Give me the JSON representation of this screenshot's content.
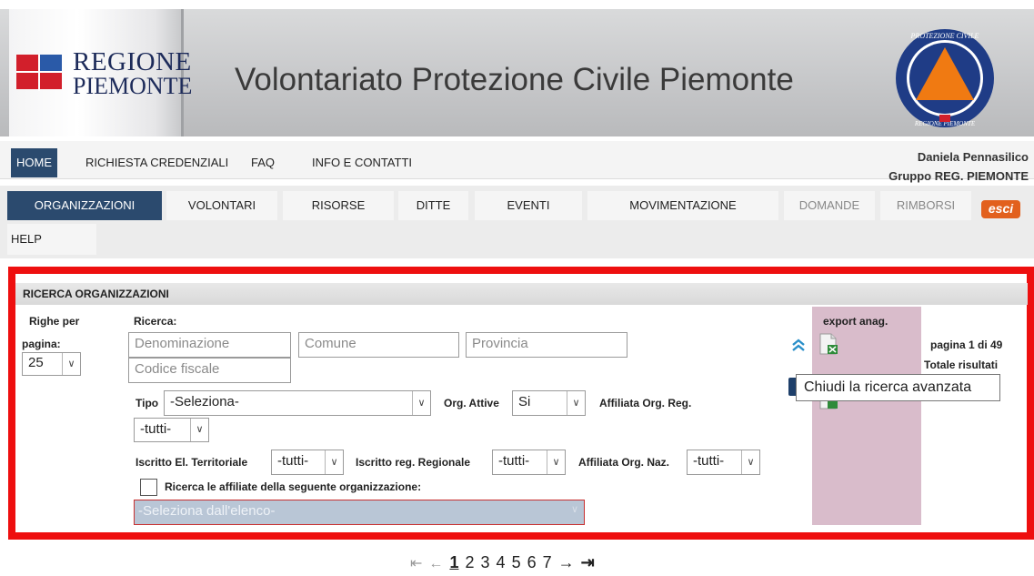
{
  "header": {
    "brand_line1": "REGIONE",
    "brand_line2": "PIEMONTE",
    "title": "Volontariato Protezione Civile Piemonte",
    "emblem_top": "PROTEZIONE CIVILE",
    "emblem_bottom": "REGIONE PIEMONTE"
  },
  "nav_primary": {
    "items": [
      "HOME",
      "RICHIESTA CREDENZIALI",
      "FAQ",
      "INFO E CONTATTI"
    ],
    "user_name": "Daniela Pennasilico",
    "user_group": "Gruppo REG. PIEMONTE"
  },
  "nav_secondary": {
    "items": [
      "ORGANIZZAZIONI",
      "VOLONTARI",
      "RISORSE",
      "DITTE",
      "EVENTI",
      "MOVIMENTAZIONE",
      "DOMANDE",
      "RIMBORSI"
    ],
    "exit_label": "esci",
    "help_label": "HELP"
  },
  "search": {
    "panel_title": "RICERCA ORGANIZZAZIONI",
    "rows_label_1": "Righe per",
    "rows_label_2": "pagina:",
    "rows_value": "25",
    "search_label": "Ricerca:",
    "denominazione_placeholder": "Denominazione",
    "comune_placeholder": "Comune",
    "provincia_placeholder": "Provincia",
    "codice_fiscale_placeholder": "Codice fiscale",
    "tipo_label": "Tipo",
    "tipo_value": "-Seleziona-",
    "org_attive_label": "Org. Attive",
    "org_attive_value": "Si",
    "affiliata_reg_label": "Affiliata Org. Reg.",
    "affiliata_reg_value": "-tutti-",
    "iscritto_terr_label": "Iscritto El. Territoriale",
    "iscritto_terr_value": "-tutti-",
    "iscritto_reg_label": "Iscritto reg. Regionale",
    "iscritto_reg_value": "-tutti-",
    "affiliata_naz_label": "Affiliata Org. Naz.",
    "affiliata_naz_value": "-tutti-",
    "affiliate_checkbox_label": "Ricerca le affiliate della seguente organizzazione:",
    "org_select_value": "-Seleziona dall'elenco-"
  },
  "export": {
    "label": "export anag.",
    "pagina_info": "pagina 1 di 49",
    "totale_label": "Totale risultati",
    "tooltip": "Chiudi la ricerca avanzata"
  },
  "pagination": {
    "pages": [
      "1",
      "2",
      "3",
      "4",
      "5",
      "6",
      "7"
    ],
    "current": "1"
  },
  "colors": {
    "nav_active": "#2b4a6e",
    "highlight_frame": "#ee0f0f",
    "exit_button": "#e2601d",
    "export_panel": "#d9bccb"
  }
}
